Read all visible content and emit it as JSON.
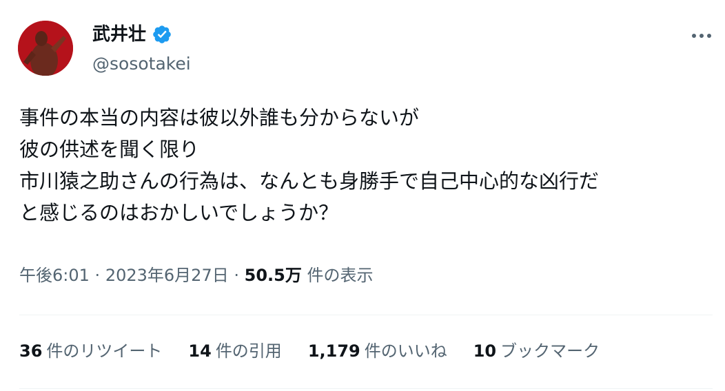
{
  "author": {
    "name": "武井壮",
    "handle": "@sosotakei",
    "verified": true,
    "avatar_color": "#c4141a"
  },
  "tweet": {
    "lines": [
      "事件の本当の内容は彼以外誰も分からないが",
      "彼の供述を聞く限り",
      "市川猿之助さんの行為は、なんとも身勝手で自己中心的な凶行だ",
      "と感じるのはおかしいでしょうか？"
    ]
  },
  "meta": {
    "time": "午後6:01",
    "separator": "·",
    "date": "2023年6月27日",
    "views_count": "50.5万",
    "views_label": "件の表示"
  },
  "stats": [
    {
      "count": "36",
      "label": "件のリツイート"
    },
    {
      "count": "14",
      "label": "件の引用"
    },
    {
      "count": "1,179",
      "label": "件のいいね"
    },
    {
      "count": "10",
      "label": "ブックマーク"
    }
  ],
  "icons": {
    "verified": "verified-badge-icon",
    "more": "more-dots-icon"
  },
  "colors": {
    "text": "#0f1419",
    "secondary": "#536471",
    "verified": "#1d9bf0"
  }
}
